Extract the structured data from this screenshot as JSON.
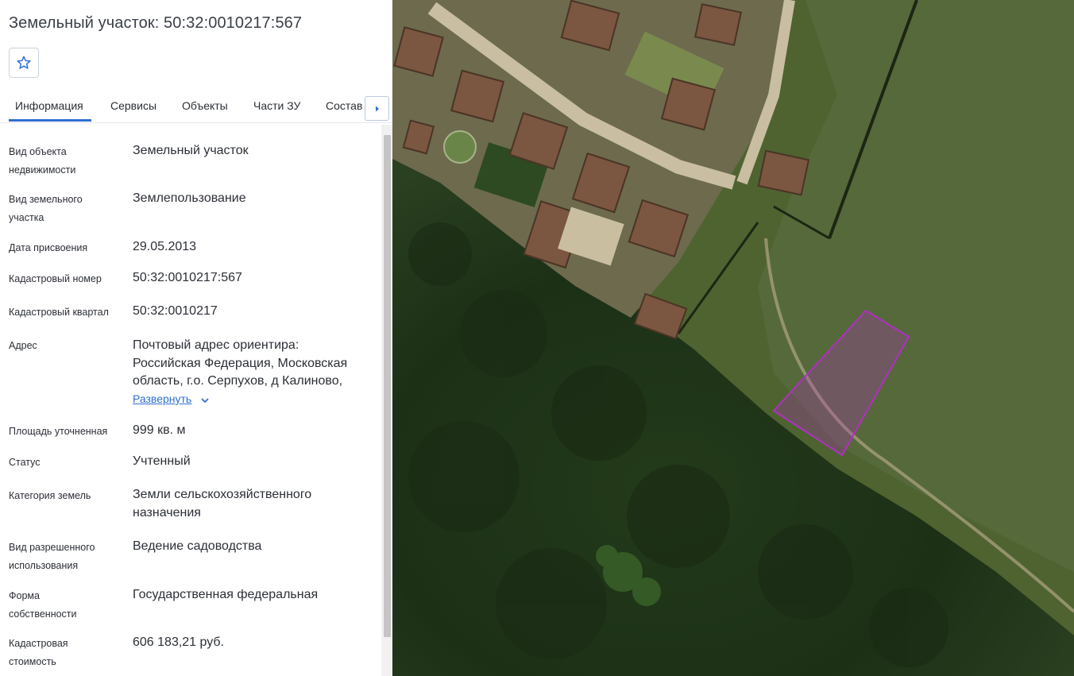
{
  "header": {
    "title": "Земельный участок: 50:32:0010217:567"
  },
  "favorite": {
    "icon": "star-outline-icon"
  },
  "tabs": [
    {
      "label": "Информация",
      "active": true
    },
    {
      "label": "Сервисы"
    },
    {
      "label": "Объекты"
    },
    {
      "label": "Части ЗУ"
    },
    {
      "label": "Состав"
    }
  ],
  "tab_next_icon": "chevron-right-icon",
  "info": {
    "object_type": {
      "label_1": "Вид объекта",
      "label_2": "недвижимости",
      "value": "Земельный участок"
    },
    "land_type": {
      "label_1": "Вид земельного",
      "label_2": "участка",
      "value": "Землепользование"
    },
    "assign_date": {
      "label": "Дата присвоения",
      "value": "29.05.2013"
    },
    "cad_number": {
      "label": "Кадастровый номер",
      "value": "50:32:0010217:567"
    },
    "cad_quarter": {
      "label": "Кадастровый квартал",
      "value": "50:32:0010217"
    },
    "address": {
      "label": "Адрес",
      "line_1": "Почтовый адрес ориентира:",
      "line_2": "Российская Федерация, Московская",
      "line_3": "область, г.о. Серпухов, д Калиново,",
      "expand": "Развернуть"
    },
    "area": {
      "label": "Площадь уточненная",
      "value": "999 кв. м"
    },
    "status": {
      "label": "Статус",
      "value": "Учтенный"
    },
    "category": {
      "label": "Категория земель",
      "value_1": "Земли сельскохозяйственного",
      "value_2": "назначения"
    },
    "permitted_use": {
      "label_1": "Вид разрешенного",
      "label_2": "использования",
      "value": "Ведение садоводства"
    },
    "ownership": {
      "label_1": "Форма",
      "label_2": "собственности",
      "value": "Государственная федеральная"
    },
    "cad_value": {
      "label_1": "Кадастровая",
      "label_2": "стоимость",
      "value": "606 183,21 руб."
    }
  },
  "colors": {
    "accent": "#2f6fd1",
    "parcel_outline": "#b02fc4"
  }
}
